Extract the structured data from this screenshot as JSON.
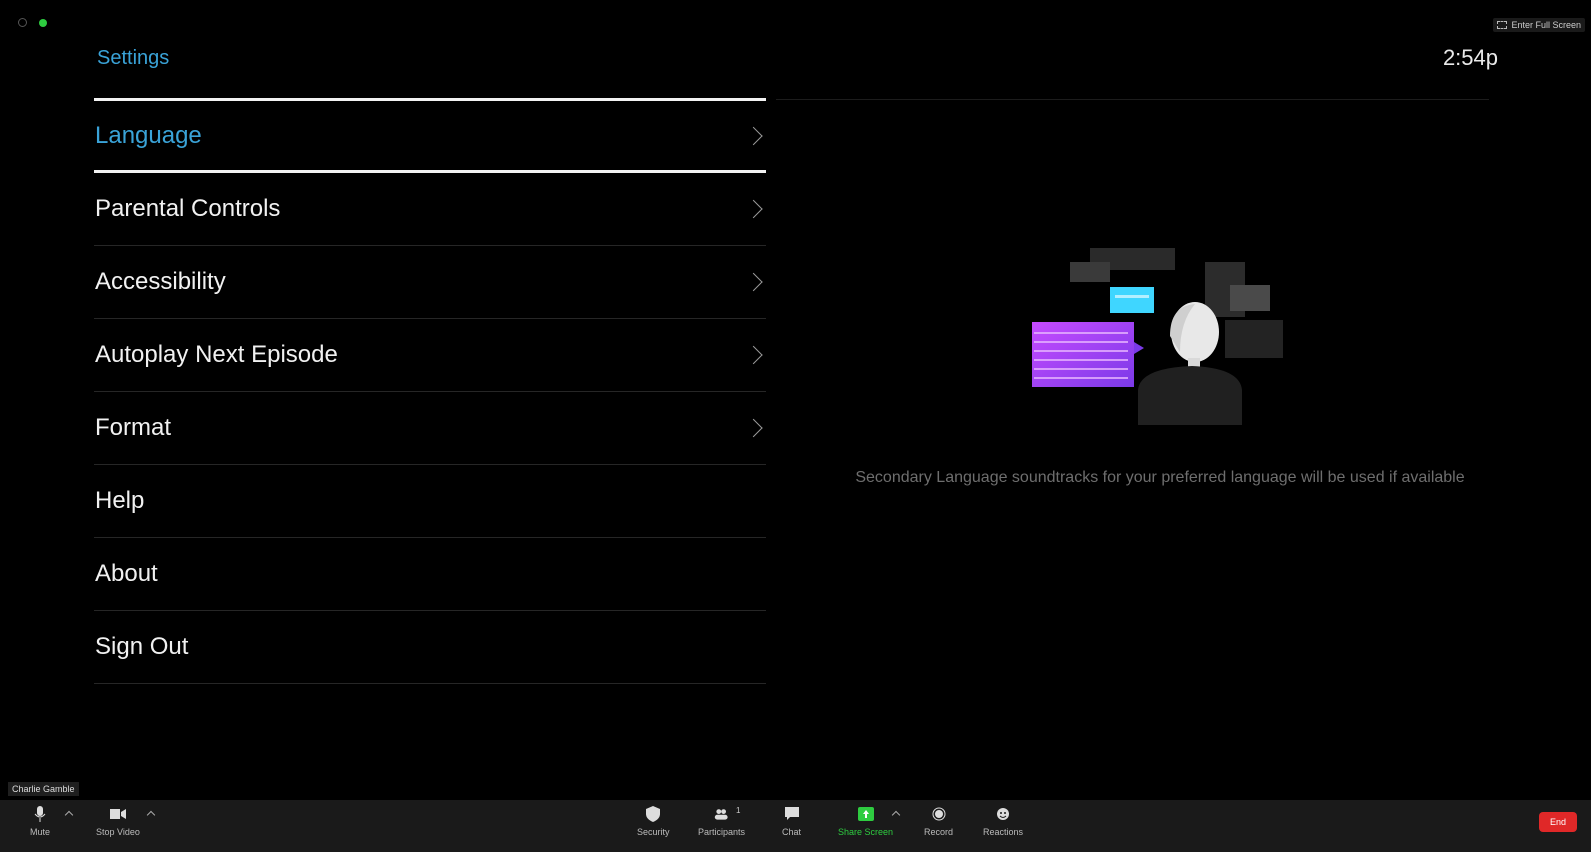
{
  "window": {
    "fullscreen_label": "Enter Full Screen"
  },
  "header": {
    "title": "Settings",
    "clock": "2:54p"
  },
  "menu": {
    "items": [
      {
        "label": "Language",
        "active": true,
        "chevron": true
      },
      {
        "label": "Parental Controls",
        "chevron": true
      },
      {
        "label": "Accessibility",
        "chevron": true
      },
      {
        "label": "Autoplay Next Episode",
        "chevron": true
      },
      {
        "label": "Format",
        "chevron": true
      },
      {
        "label": "Help",
        "chevron": false
      },
      {
        "label": "About",
        "chevron": false
      },
      {
        "label": "Sign Out",
        "chevron": false
      }
    ]
  },
  "detail": {
    "text": "Secondary Language soundtracks for your preferred language will be used if available"
  },
  "meeting": {
    "participant_name": "Charlie Gamble",
    "toolbar": {
      "mute": "Mute",
      "stop_video": "Stop Video",
      "security": "Security",
      "participants": "Participants",
      "participants_count": "1",
      "chat": "Chat",
      "share_screen": "Share Screen",
      "record": "Record",
      "reactions": "Reactions",
      "end": "End"
    }
  },
  "colors": {
    "accent": "#3aa3d8",
    "share_green": "#2ecc40",
    "end_red": "#e02828"
  }
}
